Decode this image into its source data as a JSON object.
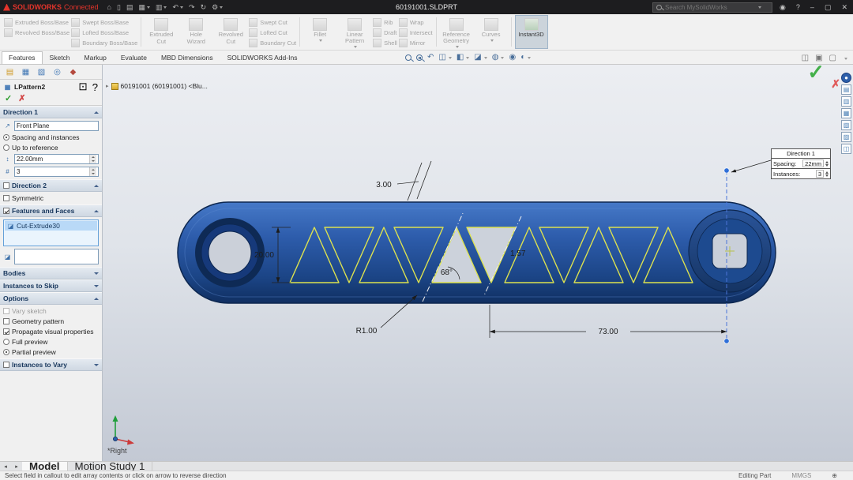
{
  "titlebar": {
    "brand": "SOLIDWORKS",
    "brand_suffix": "Connected",
    "document_title": "60191001.SLDPRT",
    "search_placeholder": "Search MySolidWorks"
  },
  "tabs": {
    "items": [
      "Features",
      "Sketch",
      "Markup",
      "Evaluate",
      "MBD Dimensions",
      "SOLIDWORKS Add-Ins"
    ]
  },
  "ribbon": {
    "extruded_boss": "Extruded Boss/Base",
    "revolved_boss": "Revolved Boss/Base",
    "swept_boss": "Swept Boss/Base",
    "lofted_boss": "Lofted Boss/Base",
    "boundary_boss": "Boundary Boss/Base",
    "extruded_cut": "Extruded Cut",
    "hole_wizard": "Hole Wizard",
    "revolved_cut": "Revolved Cut",
    "swept_cut": "Swept Cut",
    "lofted_cut": "Lofted Cut",
    "boundary_cut": "Boundary Cut",
    "fillet": "Fillet",
    "linear_pattern": "Linear Pattern",
    "rib": "Rib",
    "draft": "Draft",
    "shell": "Shell",
    "wrap": "Wrap",
    "intersect": "Intersect",
    "mirror": "Mirror",
    "reference_geometry": "Reference Geometry",
    "curves": "Curves",
    "instant3d": "Instant3D"
  },
  "feature_tree": {
    "root": "60191001 (60191001) <Blu..."
  },
  "property_manager": {
    "title": "LPattern2",
    "direction1": {
      "label": "Direction 1",
      "plane": "Front Plane",
      "radio_spacing": "Spacing and instances",
      "radio_up_to": "Up to reference",
      "spacing_value": "22.00mm",
      "instances_value": "3"
    },
    "direction2": {
      "label": "Direction 2",
      "symmetric": "Symmetric"
    },
    "features_faces": {
      "label": "Features and Faces",
      "item": "Cut-Extrude30"
    },
    "bodies": {
      "label": "Bodies"
    },
    "instances_skip": {
      "label": "Instances to Skip"
    },
    "options": {
      "label": "Options",
      "vary_sketch": "Vary sketch",
      "geometry_pattern": "Geometry pattern",
      "propagate": "Propagate visual properties",
      "full_preview": "Full preview",
      "partial_preview": "Partial preview"
    },
    "instances_vary": {
      "label": "Instances to Vary"
    }
  },
  "viewport": {
    "view_label": "*Right",
    "dimensions": {
      "spacing": "3.00",
      "height": "20.00",
      "angle": "68°",
      "gap": "1.57",
      "radius": "R1.00",
      "length": "73.00"
    },
    "callout": {
      "title": "Direction 1",
      "spacing_label": "Spacing:",
      "spacing_value": "22mm",
      "instances_label": "Instances:",
      "instances_value": "3"
    }
  },
  "model_tabs": {
    "items": [
      "Model",
      "Motion Study 1"
    ]
  },
  "statusbar": {
    "message": "Select field in callout to edit array contents or click on arrow to reverse direction",
    "mode": "Editing Part",
    "units": "MMGS"
  },
  "colors": {
    "part_blue": "#2d5caa",
    "preview_yellow": "#dde24f",
    "accent_red": "#e4342b"
  },
  "icons": {
    "home": "⌂",
    "new_doc": "▯",
    "open": "▤",
    "save": "▦",
    "print": "▥",
    "undo": "↶",
    "redo": "↷",
    "rebuild": "↻",
    "settings": "⚙",
    "help": "?",
    "minimize": "–",
    "maximize": "▢",
    "close": "✕",
    "user": "◉",
    "check": "✓",
    "cross": "✗",
    "tree_arrow": "▸",
    "prev_view": "↶",
    "section": "◫",
    "orientation": "◧",
    "display": "◪",
    "hide": "◍",
    "appearance": "◉",
    "vsettings": "◐",
    "pane1": "◫",
    "pane2": "▣",
    "pane3": "▢",
    "pm_tab1": "▤",
    "pm_tab2": "▦",
    "pm_tab3": "▧",
    "pm_tab4": "◎",
    "pm_tab5": "◆",
    "feedback": "⊡",
    "strip1": "●",
    "strip2": "▤",
    "strip3": "▥",
    "strip4": "▦",
    "strip5": "▧",
    "strip6": "▨",
    "strip7": "◫",
    "plane": "↗",
    "spacing_ico": "↕",
    "count_ico": "#",
    "face_ico": "◪",
    "cut_item": "◪",
    "skip_ico": "⊘",
    "globe": "⊕",
    "mt1": "◂",
    "mt2": "▸"
  }
}
